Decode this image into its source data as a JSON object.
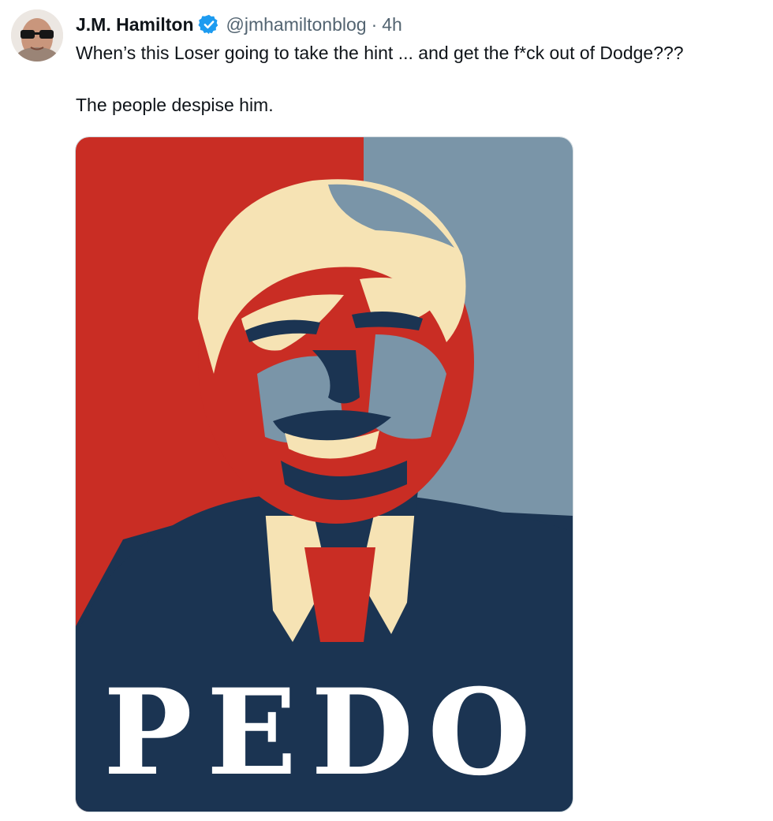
{
  "tweet": {
    "author": {
      "display_name": "J.M. Hamilton",
      "handle": "@jmhamiltonblog",
      "verified_icon": "verified-badge-icon"
    },
    "separator": "·",
    "time": "4h",
    "text_line1": "When’s this Loser going to take the hint  ... and get the f*ck out of Dodge???",
    "text_line2": "The people despise him.",
    "media": {
      "poster_word": "PEDO"
    }
  },
  "colors": {
    "accent": "#1d9bf0",
    "text": "#0f1419",
    "secondary_text": "#536471",
    "poster_red": "#c92d24",
    "poster_blue": "#7a95a8",
    "poster_navy": "#1b3452",
    "poster_cream": "#f6e3b4"
  }
}
